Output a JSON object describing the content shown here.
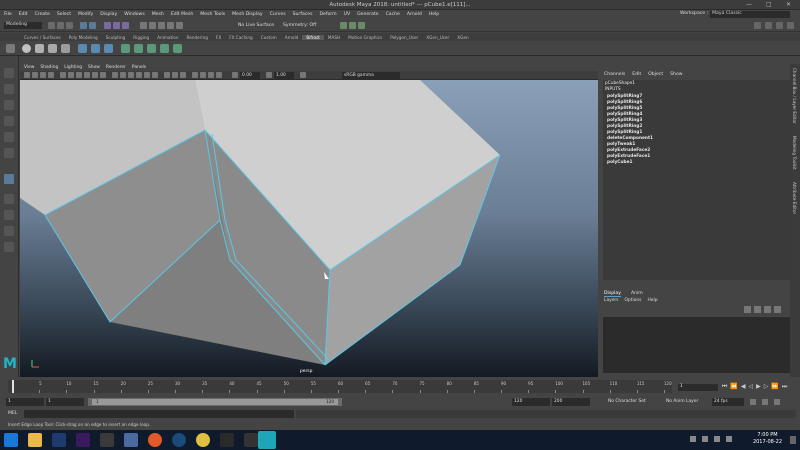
{
  "window": {
    "title": "Autodesk Maya 2018: untitled*  ---  pCube1.e[111]..."
  },
  "menus": [
    "File",
    "Edit",
    "Create",
    "Select",
    "Modify",
    "Display",
    "Windows",
    "Mesh",
    "Edit Mesh",
    "Mesh Tools",
    "Mesh Display",
    "Curves",
    "Surfaces",
    "Deform",
    "UV",
    "Generate",
    "Cache",
    "Arnold",
    "Help"
  ],
  "workspace": {
    "label": "Workspace :",
    "value": "Maya Classic"
  },
  "status": {
    "mode": "Modeling",
    "live_surface": "No Live Surface",
    "symmetry": "Symmetry: Off"
  },
  "shelf_tabs": [
    "Curves / Surfaces",
    "Poly Modeling",
    "Sculpting",
    "Rigging",
    "Animation",
    "Rendering",
    "FX",
    "FX Caching",
    "Custom",
    "Arnold",
    "Bifrost",
    "MASH",
    "Motion Graphics",
    "Polygon_User",
    "XGen_User",
    "XGen"
  ],
  "shelf_active": "Bifrost",
  "panel_menu": [
    "View",
    "Shading",
    "Lighting",
    "Show",
    "Renderer",
    "Panels"
  ],
  "panel_toolbar": {
    "v1": "0.00",
    "v2": "1.00",
    "colorspace": "sRGB gamma"
  },
  "viewport": {
    "camera": "persp"
  },
  "channel_box": {
    "menu": [
      "Channels",
      "Edit",
      "Object",
      "Show"
    ],
    "object": "pCubeShape1",
    "inputs_label": "INPUTS",
    "inputs": [
      "polySplitRing7",
      "polySplitRing6",
      "polySplitRing5",
      "polySplitRing4",
      "polySplitRing3",
      "polySplitRing2",
      "polySplitRing1",
      "deleteComponent1",
      "polyTweak1",
      "polyExtrudeFace2",
      "polyExtrudeFace1",
      "polyCube1"
    ]
  },
  "layer_editor": {
    "tabs": [
      "Display",
      "Anim"
    ],
    "active": "Display",
    "menu": [
      "Layers",
      "Options",
      "Help"
    ]
  },
  "side_tabs": [
    "Channel Box / Layer Editor",
    "Modeling Toolkit",
    "Attribute Editor"
  ],
  "timeline": {
    "ticks": [
      "1",
      "5",
      "10",
      "15",
      "20",
      "25",
      "30",
      "35",
      "40",
      "45",
      "50",
      "55",
      "60",
      "65",
      "70",
      "75",
      "80",
      "85",
      "90",
      "95",
      "100",
      "105",
      "110",
      "115",
      "120"
    ],
    "current_frame": "1"
  },
  "range": {
    "start": "1",
    "inner_start": "1",
    "inner_label": "1",
    "inner_end": "120",
    "end_a": "120",
    "end_b": "200",
    "char_set": "No Character Set",
    "anim_layer": "No Anim Layer",
    "fps": "24 fps"
  },
  "command": {
    "label": "MEL"
  },
  "help_line": "Insert Edge Loop Tool: Click-drag on an edge to insert an edge loop.",
  "taskbar": {
    "time": "7:00 PM",
    "date": "2017-08-22"
  },
  "colors": {
    "accent": "#5ac8e6",
    "viewport_top": "#8aa0b8",
    "viewport_bottom": "#141a22"
  }
}
